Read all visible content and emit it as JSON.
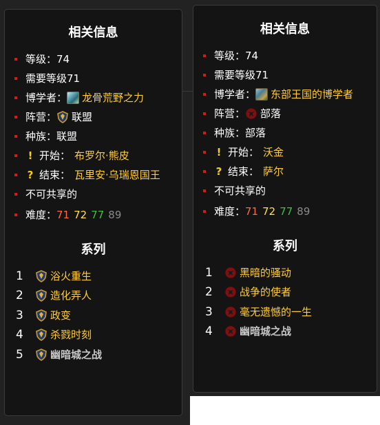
{
  "left_panel": {
    "title": "相关信息",
    "level_label": "等级：",
    "level_value": "74",
    "req_level": "需要等级71",
    "loremaster_label": "博学者：",
    "loremaster_value": "龙骨荒野之力",
    "faction_label": "阵营：",
    "faction_value": "联盟",
    "race_label": "种族：",
    "race_value": "联盟",
    "start_label": "开始：",
    "start_value": "布罗尔·熊皮",
    "end_label": "结束：",
    "end_value": "瓦里安·乌瑞恩国王",
    "shareable": "不可共享的",
    "difficulty_label": "难度：",
    "difficulty": [
      "71",
      "72",
      "77",
      "89"
    ],
    "series_title": "系列",
    "series": [
      {
        "num": "1",
        "name": "浴火重生"
      },
      {
        "num": "2",
        "name": "造化弄人"
      },
      {
        "num": "3",
        "name": "政变"
      },
      {
        "num": "4",
        "name": "杀戮时刻"
      },
      {
        "num": "5",
        "name": "幽暗城之战"
      }
    ]
  },
  "right_panel": {
    "title": "相关信息",
    "level_label": "等级：",
    "level_value": "74",
    "req_level": "需要等级71",
    "loremaster_label": "博学者：",
    "loremaster_value": "东部王国的博学者",
    "faction_label": "阵营：",
    "faction_value": "部落",
    "race_label": "种族：",
    "race_value": "部落",
    "start_label": "开始：",
    "start_value": "沃金",
    "end_label": "结束：",
    "end_value": "萨尔",
    "shareable": "不可共享的",
    "difficulty_label": "难度：",
    "difficulty": [
      "71",
      "72",
      "77",
      "89"
    ],
    "series_title": "系列",
    "series": [
      {
        "num": "1",
        "name": "黑暗的骚动"
      },
      {
        "num": "2",
        "name": "战争的使者"
      },
      {
        "num": "3",
        "name": "毫无遗憾的一生"
      },
      {
        "num": "4",
        "name": "幽暗城之战"
      }
    ]
  },
  "colors": {
    "link": "#ffcc33",
    "bullet": "#d21b1b",
    "difficulty": [
      "#ff6a3d",
      "#ffe33d",
      "#40c040",
      "#8a8a8a"
    ]
  },
  "icons": [
    "alliance-crest-icon",
    "horde-crest-icon",
    "exclamation-icon",
    "question-icon",
    "loremaster-achievement-icon"
  ]
}
